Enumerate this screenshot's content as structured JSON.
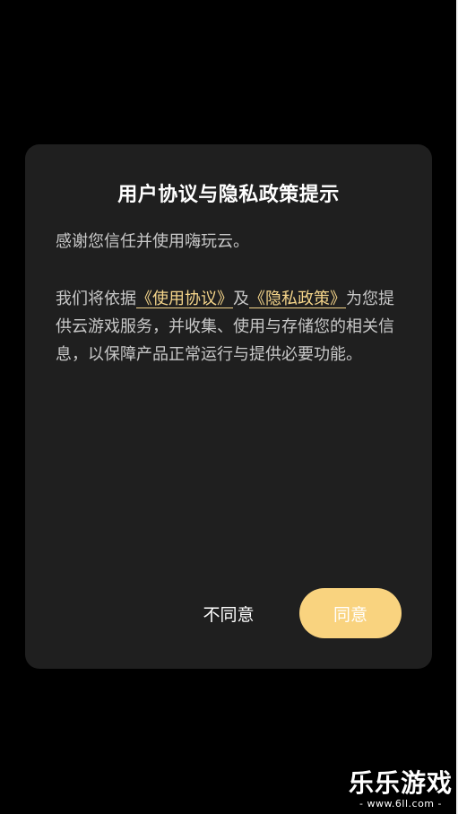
{
  "dialog": {
    "title": "用户协议与隐私政策提示",
    "greeting": "感谢您信任并使用嗨玩云。",
    "policy_prefix": "我们将依据",
    "terms_link": "《使用协议》",
    "conjunction": "及",
    "privacy_link": "《隐私政策》",
    "policy_suffix": "为您提供云游戏服务，并收集、使用与存储您的相关信息，以保障产品正常运行与提供必要功能。",
    "disagree_label": "不同意",
    "agree_label": "同意"
  },
  "watermark": {
    "brand": "乐乐游戏",
    "url": "- www.6ll.com -"
  },
  "colors": {
    "background": "#000000",
    "dialog_bg": "#1f1f1f",
    "link": "#f5d58a",
    "agree_button": "#f9d37f"
  }
}
